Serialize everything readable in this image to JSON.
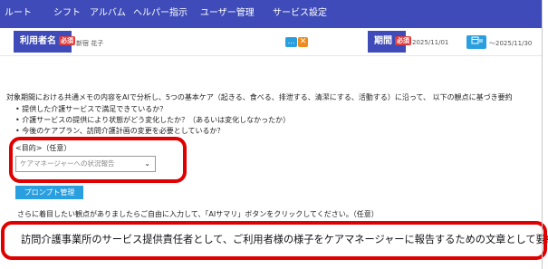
{
  "nav": {
    "items": [
      "ルート",
      "シフト",
      "アルバム",
      "ヘルパー指示",
      "ユーザー管理",
      "サービス設定"
    ]
  },
  "filters": {
    "user_label": "利用者名",
    "required_badge": "必須",
    "user_value": "新宿 花子",
    "more_button": "…",
    "clear_button": "✕",
    "period_label": "期間",
    "period_from": "2025/11/01",
    "period_to": "～2025/11/30",
    "calendar_icon": "calendar-icon"
  },
  "main": {
    "intro": "対象期間における共通メモの内容をAIで分析し、5つの基本ケア（起きる、食べる、排泄する、清潔にする、活動する）に沿って、 以下の観点に基づき要約",
    "bullets": [
      "• 提供した介護サービスで満足できているか？",
      "• 介護サービスの提供により状態がどう変化したか？（あるいは変化しなかったか）",
      "• 今後のケアプラン、訪問介護計画の変更を必要としているか？"
    ],
    "purpose_label": "<目的>（任意）",
    "purpose_value": "ケアマネージャーへの状況報告",
    "prompt_button": "プロンプト管理",
    "extra_note": "さらに着目したい観点がありましたらご自由に入力して、「AIサマリ」ボタンをクリックしてください。（任意）",
    "extra_text": "訪問介護事業所のサービス提供責任者として、ご利用者様の様子をケアマネージャーに報告するための文章として要約して"
  },
  "colors": {
    "nav_bg": "#3e4bb8",
    "accent_blue": "#2a9fe0",
    "required_red": "#e23c3c",
    "highlight_red": "#e00000",
    "clear_orange": "#ee8a1e"
  }
}
